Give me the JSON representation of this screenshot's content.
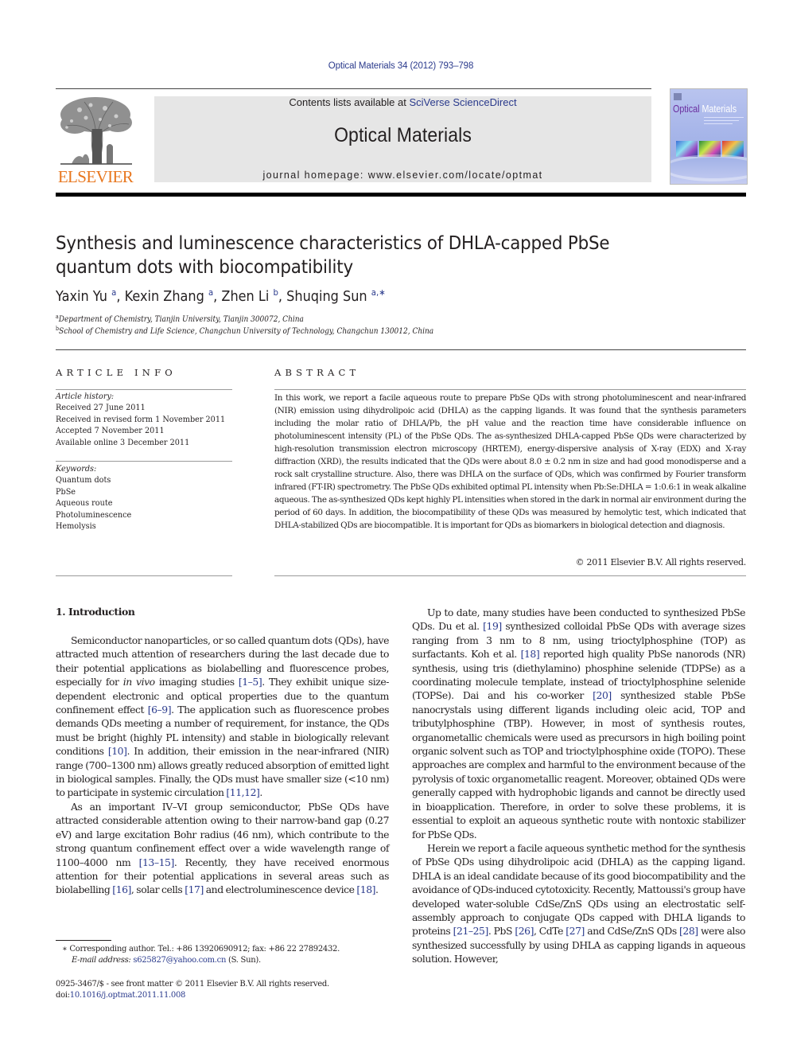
{
  "header": {
    "citation": "Optical Materials 34 (2012) 793–798",
    "contents_prefix": "Contents lists available at ",
    "contents_link": "SciVerse ScienceDirect",
    "journal_title": "Optical Materials",
    "homepage_prefix": "journal homepage: ",
    "homepage_url": "www.elsevier.com/locate/optmat",
    "publisher_logo_text": "ELSEVIER",
    "cover_title_part1": "Optical",
    "cover_title_part2": "Materials",
    "colors": {
      "link": "#2a3a8c",
      "elsevier_orange": "#e8771f",
      "masthead_bg": "#e6e6e6"
    }
  },
  "article": {
    "title": "Synthesis and luminescence characteristics of DHLA-capped PbSe quantum dots with biocompatibility",
    "authors": [
      {
        "name": "Yaxin Yu",
        "sup": "a"
      },
      {
        "name": "Kexin Zhang",
        "sup": "a"
      },
      {
        "name": "Zhen Li",
        "sup": "b"
      },
      {
        "name": "Shuqing Sun",
        "sup": "a,∗"
      }
    ],
    "affiliations": [
      {
        "key": "a",
        "text": "Department of Chemistry, Tianjin University, Tianjin 300072, China"
      },
      {
        "key": "b",
        "text": "School of Chemistry and Life Science, Changchun University of Technology, Changchun 130012, China"
      }
    ]
  },
  "article_info": {
    "heading": "ARTICLE INFO",
    "history_label": "Article history:",
    "history": [
      "Received 27 June 2011",
      "Received in revised form 1 November 2011",
      "Accepted 7 November 2011",
      "Available online 3 December 2011"
    ],
    "keywords_label": "Keywords:",
    "keywords": [
      "Quantum dots",
      "PbSe",
      "Aqueous route",
      "Photoluminescence",
      "Hemolysis"
    ]
  },
  "abstract": {
    "heading": "ABSTRACT",
    "text": "In this work, we report a facile aqueous route to prepare PbSe QDs with strong photoluminescent and near-infrared (NIR) emission using dihydrolipoic acid (DHLA) as the capping ligands. It was found that the synthesis parameters including the molar ratio of DHLA/Pb, the pH value and the reaction time have considerable influence on photoluminescent intensity (PL) of the PbSe QDs. The as-synthesized DHLA-capped PbSe QDs were characterized by high-resolution transmission electron microscopy (HRTEM), energy-dispersive analysis of X-ray (EDX) and X-ray diffraction (XRD), the results indicated that the QDs were about 8.0 ± 0.2 nm in size and had good monodisperse and a rock salt crystalline structure. Also, there was DHLA on the surface of QDs, which was confirmed by Fourier transform infrared (FT-IR) spectrometry. The PbSe QDs exhibited optimal PL intensity when Pb:Se:DHLA = 1:0.6:1 in weak alkaline aqueous. The as-synthesized QDs kept highly PL intensities when stored in the dark in normal air environment during the period of 60 days. In addition, the biocompatibility of these QDs was measured by hemolytic test, which indicated that DHLA-stabilized QDs are biocompatible. It is important for QDs as biomarkers in biological detection and diagnosis.",
    "copyright": "© 2011 Elsevier B.V. All rights reserved."
  },
  "body": {
    "section_heading": "1. Introduction",
    "left_paragraphs": [
      [
        {
          "t": "Semiconductor nanoparticles, or so called quantum dots (QDs), have attracted much attention of researchers during the last decade due to their potential applications as biolabelling and fluorescence probes, especially for "
        },
        {
          "t": "in vivo",
          "i": true
        },
        {
          "t": " imaging studies "
        },
        {
          "t": "[1–5]",
          "ref": true
        },
        {
          "t": ". They exhibit unique size-dependent electronic and optical properties due to the quantum confinement effect "
        },
        {
          "t": "[6–9]",
          "ref": true
        },
        {
          "t": ". The application such as fluorescence probes demands QDs meeting a number of requirement, for instance, the QDs must be bright (highly PL intensity) and stable in biologically relevant conditions "
        },
        {
          "t": "[10]",
          "ref": true
        },
        {
          "t": ". In addition, their emission in the near-infrared (NIR) range (700–1300 nm) allows greatly reduced absorption of emitted light in biological samples. Finally, the QDs must have smaller size (<10 nm) to participate in systemic circulation "
        },
        {
          "t": "[11,12]",
          "ref": true
        },
        {
          "t": "."
        }
      ],
      [
        {
          "t": "As an important IV–VI group semiconductor, PbSe QDs have attracted considerable attention owing to their narrow-band gap (0.27 eV) and large excitation Bohr radius (46 nm), which contribute to the strong quantum confinement effect over a wide wavelength range of 1100–4000 nm "
        },
        {
          "t": "[13–15]",
          "ref": true
        },
        {
          "t": ". Recently, they have received enormous attention for their potential applications in several areas such as biolabelling "
        },
        {
          "t": "[16]",
          "ref": true
        },
        {
          "t": ", solar cells "
        },
        {
          "t": "[17]",
          "ref": true
        },
        {
          "t": " and electroluminescence device "
        },
        {
          "t": "[18]",
          "ref": true
        },
        {
          "t": "."
        }
      ]
    ],
    "right_paragraphs": [
      [
        {
          "t": "Up to date, many studies have been conducted to synthesized PbSe QDs. Du et al. "
        },
        {
          "t": "[19]",
          "ref": true
        },
        {
          "t": " synthesized colloidal PbSe QDs with average sizes ranging from 3 nm to 8 nm, using trioctylphosphine (TOP) as surfactants. Koh et al. "
        },
        {
          "t": "[18]",
          "ref": true
        },
        {
          "t": " reported high quality PbSe nanorods (NR) synthesis, using tris (diethylamino) phosphine selenide (TDPSe) as a coordinating molecule template, instead of trioctylphosphine selenide (TOPSe). Dai and his co-worker "
        },
        {
          "t": "[20]",
          "ref": true
        },
        {
          "t": " synthesized stable PbSe nanocrystals using different ligands including oleic acid, TOP and tributylphosphine (TBP). However, in most of synthesis routes, organometallic chemicals were used as precursors in high boiling point organic solvent such as TOP and trioctylphosphine oxide (TOPO). These approaches are complex and harmful to the environment because of the pyrolysis of toxic organometallic reagent. Moreover, obtained QDs were generally capped with hydrophobic ligands and cannot be directly used in bioapplication. Therefore, in order to solve these problems, it is essential to exploit an aqueous synthetic route with nontoxic stabilizer for PbSe QDs."
        }
      ],
      [
        {
          "t": "Herein we report a facile aqueous synthetic method for the synthesis of PbSe QDs using dihydrolipoic acid (DHLA) as the capping ligand. DHLA is an ideal candidate because of its good biocompatibility and the avoidance of QDs-induced cytotoxicity. Recently, Mattoussi's group have developed water-soluble CdSe/ZnS QDs using an electrostatic self-assembly approach to conjugate QDs capped with DHLA ligands to proteins "
        },
        {
          "t": "[21–25]",
          "ref": true
        },
        {
          "t": ". PbS "
        },
        {
          "t": "[26]",
          "ref": true
        },
        {
          "t": ", CdTe "
        },
        {
          "t": "[27]",
          "ref": true
        },
        {
          "t": " and CdSe/ZnS QDs "
        },
        {
          "t": "[28]",
          "ref": true
        },
        {
          "t": " were also synthesized successfully by using DHLA as capping ligands in aqueous solution. However,"
        }
      ]
    ]
  },
  "footnotes": {
    "corresponding_marker": "∗",
    "corresponding_text": "Corresponding author. Tel.: +86 13920690912; fax: +86 22 27892432.",
    "email_label": "E-mail address:",
    "email": "s625827@yahoo.com.cn",
    "email_suffix": " (S. Sun).",
    "front_matter": "0925-3467/$ - see front matter © 2011 Elsevier B.V. All rights reserved.",
    "doi_prefix": "doi:",
    "doi": "10.1016/j.optmat.2011.11.008"
  }
}
